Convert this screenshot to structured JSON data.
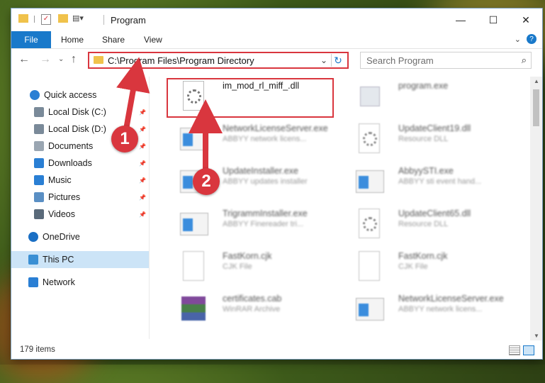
{
  "window": {
    "title": "Program",
    "controls": {
      "minimize": "—",
      "maximize": "☐",
      "close": "✕"
    }
  },
  "ribbon": {
    "tabs": [
      "File",
      "Home",
      "Share",
      "View"
    ],
    "help": "?"
  },
  "address": {
    "path": "C:\\Program Files\\Program Directory",
    "search_placeholder": "Search Program"
  },
  "sidebar": {
    "items": [
      {
        "label": "Quick access",
        "icon": "star-icon",
        "pinned": false
      },
      {
        "label": "Local Disk (C:)",
        "icon": "drive-icon",
        "pinned": true
      },
      {
        "label": "Local Disk (D:)",
        "icon": "drive-icon",
        "pinned": true
      },
      {
        "label": "Documents",
        "icon": "documents-icon",
        "pinned": true
      },
      {
        "label": "Downloads",
        "icon": "download-icon",
        "pinned": true
      },
      {
        "label": "Music",
        "icon": "music-icon",
        "pinned": true
      },
      {
        "label": "Pictures",
        "icon": "pictures-icon",
        "pinned": true
      },
      {
        "label": "Videos",
        "icon": "videos-icon",
        "pinned": true
      },
      {
        "label": "OneDrive",
        "icon": "cloud-icon",
        "pinned": false
      },
      {
        "label": "This PC",
        "icon": "computer-icon",
        "pinned": false,
        "selected": true
      },
      {
        "label": "Network",
        "icon": "network-icon",
        "pinned": false
      }
    ]
  },
  "files": [
    {
      "name": "im_mod_rl_miff_.dll",
      "desc": "",
      "icon": "dll-gear-icon"
    },
    {
      "name": "program.exe",
      "desc": "",
      "icon": "program-icon"
    },
    {
      "name": "NetworkLicenseServer.exe",
      "desc": "ABBYY network licens...",
      "icon": "app-window-icon"
    },
    {
      "name": "UpdateClient19.dll",
      "desc": "Resource DLL",
      "icon": "dll-icon"
    },
    {
      "name": "UpdateInstaller.exe",
      "desc": "ABBYY updates installer",
      "icon": "app-window-icon"
    },
    {
      "name": "AbbyySTI.exe",
      "desc": "ABBYY sti event hand...",
      "icon": "app-window-icon"
    },
    {
      "name": "TrigrammInstaller.exe",
      "desc": "ABBYY Finereader tri...",
      "icon": "app-window-icon"
    },
    {
      "name": "UpdateClient65.dll",
      "desc": "Resource DLL",
      "icon": "dll-icon"
    },
    {
      "name": "FastKorn.cjk",
      "desc": "CJK File",
      "icon": "blank-file-icon"
    },
    {
      "name": "FastKorn.cjk",
      "desc": "CJK File",
      "icon": "blank-file-icon"
    },
    {
      "name": "certificates.cab",
      "desc": "WinRAR Archive",
      "icon": "winrar-icon"
    },
    {
      "name": "NetworkLicenseServer.exe",
      "desc": "ABBYY network licens...",
      "icon": "app-window-icon"
    }
  ],
  "status": {
    "count": "179 items"
  },
  "annotations": {
    "step1": "1",
    "step2": "2"
  },
  "colors": {
    "accent": "#1979ca",
    "highlight": "#d9363e",
    "selected": "#cce4f7"
  }
}
